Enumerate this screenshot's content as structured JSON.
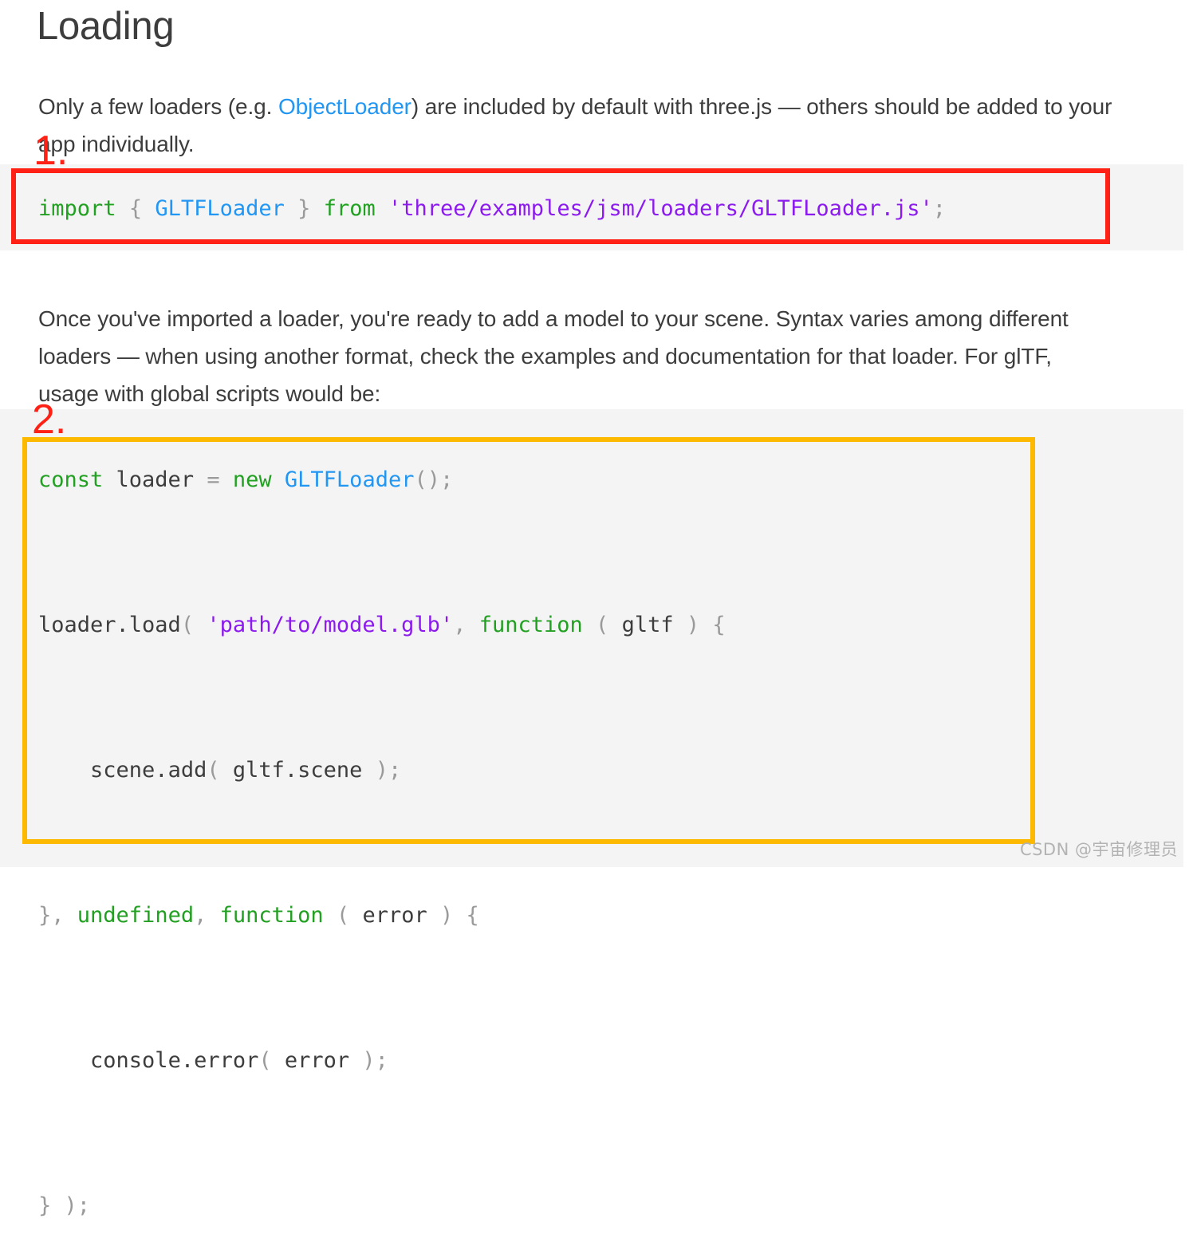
{
  "page": {
    "title": "Loading",
    "watermark": "CSDN @宇宙修理员",
    "background": "#ffffff",
    "text_color": "#3d3d3d"
  },
  "paragraphs": {
    "intro": {
      "before_link": "Only a few loaders (e.g. ",
      "link_text": "ObjectLoader",
      "link_color": "#2196f3",
      "after_link": ") are included by default with three.js — others should be added to your app individually."
    },
    "middle": "Once you've imported a loader, you're ready to add a model to your scene. Syntax varies among different loaders — when using another format, check the examples and documentation for that loader. For glTF, usage with global scripts would be:"
  },
  "code_blocks": [
    {
      "id": "code-block-1",
      "background": "#f4f4f4",
      "plain_text": "import { GLTFLoader } from 'three/examples/jsm/loaders/GLTFLoader.js';",
      "tokens": [
        {
          "t": "import",
          "k": "kw"
        },
        {
          "t": " ",
          "k": "id"
        },
        {
          "t": "{",
          "k": "pun"
        },
        {
          "t": " ",
          "k": "id"
        },
        {
          "t": "GLTFLoader",
          "k": "cls"
        },
        {
          "t": " ",
          "k": "id"
        },
        {
          "t": "}",
          "k": "pun"
        },
        {
          "t": " ",
          "k": "id"
        },
        {
          "t": "from",
          "k": "kw"
        },
        {
          "t": " ",
          "k": "id"
        },
        {
          "t": "'three/examples/jsm/loaders/GLTFLoader.js'",
          "k": "str"
        },
        {
          "t": ";",
          "k": "pun"
        }
      ]
    },
    {
      "id": "code-block-2",
      "background": "#f4f4f4",
      "plain_text": "const loader = new GLTFLoader();\n\nloader.load( 'path/to/model.glb', function ( gltf ) {\n\n    scene.add( gltf.scene );\n\n}, undefined, function ( error ) {\n\n    console.error( error );\n\n} );",
      "tokens": [
        {
          "t": "const",
          "k": "kw"
        },
        {
          "t": " loader ",
          "k": "id"
        },
        {
          "t": "=",
          "k": "pun"
        },
        {
          "t": " ",
          "k": "id"
        },
        {
          "t": "new",
          "k": "kw"
        },
        {
          "t": " ",
          "k": "id"
        },
        {
          "t": "GLTFLoader",
          "k": "cls"
        },
        {
          "t": "();",
          "k": "pun"
        },
        {
          "t": "\n\n",
          "k": "id"
        },
        {
          "t": "loader.load",
          "k": "id"
        },
        {
          "t": "(",
          "k": "pun"
        },
        {
          "t": " ",
          "k": "id"
        },
        {
          "t": "'path/to/model.glb'",
          "k": "str"
        },
        {
          "t": ",",
          "k": "pun"
        },
        {
          "t": " ",
          "k": "id"
        },
        {
          "t": "function",
          "k": "kw"
        },
        {
          "t": " ",
          "k": "id"
        },
        {
          "t": "(",
          "k": "pun"
        },
        {
          "t": " gltf ",
          "k": "id"
        },
        {
          "t": ")",
          "k": "pun"
        },
        {
          "t": " ",
          "k": "id"
        },
        {
          "t": "{",
          "k": "pun"
        },
        {
          "t": "\n\n    ",
          "k": "id"
        },
        {
          "t": "scene.add",
          "k": "id"
        },
        {
          "t": "(",
          "k": "pun"
        },
        {
          "t": " gltf.scene ",
          "k": "id"
        },
        {
          "t": ");",
          "k": "pun"
        },
        {
          "t": "\n\n",
          "k": "id"
        },
        {
          "t": "},",
          "k": "pun"
        },
        {
          "t": " ",
          "k": "id"
        },
        {
          "t": "undefined",
          "k": "kw"
        },
        {
          "t": ",",
          "k": "pun"
        },
        {
          "t": " ",
          "k": "id"
        },
        {
          "t": "function",
          "k": "kw"
        },
        {
          "t": " ",
          "k": "id"
        },
        {
          "t": "(",
          "k": "pun"
        },
        {
          "t": " error ",
          "k": "id"
        },
        {
          "t": ")",
          "k": "pun"
        },
        {
          "t": " ",
          "k": "id"
        },
        {
          "t": "{",
          "k": "pun"
        },
        {
          "t": "\n\n    ",
          "k": "id"
        },
        {
          "t": "console.error",
          "k": "id"
        },
        {
          "t": "(",
          "k": "pun"
        },
        {
          "t": " error ",
          "k": "id"
        },
        {
          "t": ");",
          "k": "pun"
        },
        {
          "t": "\n\n",
          "k": "id"
        },
        {
          "t": "} );",
          "k": "pun"
        }
      ]
    }
  ],
  "annotations": [
    {
      "label": "1.",
      "color": "#ff2116",
      "target": "code-block-1"
    },
    {
      "label": "2.",
      "color": "#fcb900",
      "label_color": "#ff2116",
      "target": "code-block-2"
    }
  ],
  "syntax_colors": {
    "keyword": "#22a022",
    "class": "#2196f3",
    "string": "#8c1aee",
    "punctuation": "#9a9a9a",
    "identifier": "#3d3d3d"
  }
}
